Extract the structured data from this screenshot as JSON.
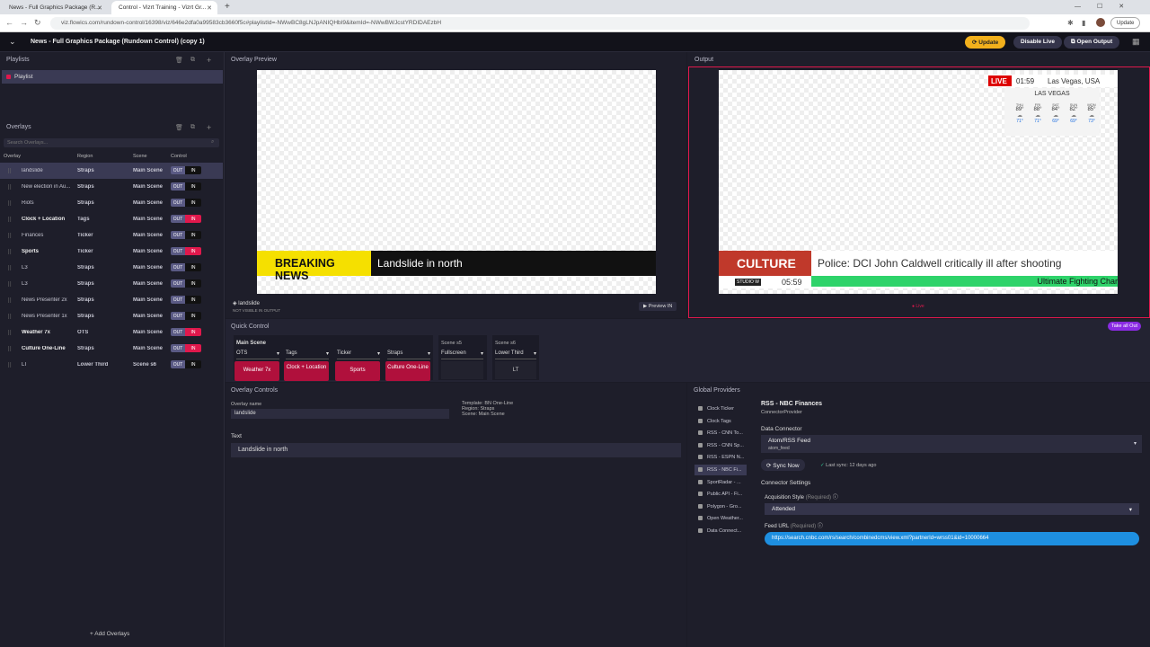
{
  "browser": {
    "tabs": [
      "News - Full Graphics Package (R...",
      "Control - Vizrt Training - Vizrt Gr..."
    ],
    "new_tab": "+",
    "url": "viz.flowics.com/rundown-control/16398/viz/646e2dfa0a99583cb3660f5c#playlistId=-NWwBC8gLNJpANIQHbI9&itemId=-NWwBWJcstYRDIDAEzbH",
    "update": "Update",
    "win_controls": [
      "—",
      "☐",
      "✕"
    ]
  },
  "header": {
    "title": "News - Full Graphics Package (Rundown Control) (copy 1)",
    "update": "Update",
    "disable_live": "Disable Live",
    "open_output": "Open Output"
  },
  "playlists": {
    "title": "Playlists",
    "items": [
      "Playlist"
    ]
  },
  "overlays": {
    "title": "Overlays",
    "search_placeholder": "Search Overlays...",
    "columns": [
      "Overlay",
      "Region",
      "Scene",
      "Control"
    ],
    "rows": [
      {
        "name": "landslide",
        "region": "Straps",
        "scene": "Main Scene",
        "in": false,
        "sel": true
      },
      {
        "name": "New election in Au...",
        "region": "Straps",
        "scene": "Main Scene",
        "in": false
      },
      {
        "name": "Riots",
        "region": "Straps",
        "scene": "Main Scene",
        "in": false
      },
      {
        "name": "Clock + Location",
        "region": "Tags",
        "scene": "Main Scene",
        "in": true
      },
      {
        "name": "Finances",
        "region": "Ticker",
        "scene": "Main Scene",
        "in": false
      },
      {
        "name": "Sports",
        "region": "Ticker",
        "scene": "Main Scene",
        "in": true
      },
      {
        "name": "L3",
        "region": "Straps",
        "scene": "Main Scene",
        "in": false
      },
      {
        "name": "L3",
        "region": "Straps",
        "scene": "Main Scene",
        "in": false
      },
      {
        "name": "News Presenter 2x",
        "region": "Straps",
        "scene": "Main Scene",
        "in": false
      },
      {
        "name": "News Presenter 1x",
        "region": "Straps",
        "scene": "Main Scene",
        "in": false
      },
      {
        "name": "Weather 7x",
        "region": "OTS",
        "scene": "Main Scene",
        "in": true
      },
      {
        "name": "Culture One-Line",
        "region": "Straps",
        "scene": "Main Scene",
        "in": true
      },
      {
        "name": "LT",
        "region": "Lower Third",
        "scene": "Scene s6",
        "in": false
      }
    ],
    "out_label": "OUT",
    "in_label": "IN",
    "add": "+ Add Overlays"
  },
  "preview": {
    "title": "Overlay Preview",
    "breaking": "BREAKING NEWS",
    "headline": "Landslide in north",
    "overlay_name": "landslide",
    "not_visible": "NOT VISIBLE IN OUTPUT",
    "preview_in": "Preview IN"
  },
  "output": {
    "title": "Output",
    "live": "LIVE",
    "time": "01:59",
    "location": "Las Vegas, USA",
    "weather_city": "LAS VEGAS",
    "days": [
      "THU",
      "FRI",
      "SAT",
      "SUN",
      "MON"
    ],
    "highs": [
      "89°",
      "88°",
      "84°",
      "82°",
      "85°"
    ],
    "lows": [
      "71°",
      "71°",
      "69°",
      "69°",
      "73°"
    ],
    "culture": "CULTURE",
    "culture_headline": "Police: DCI John Caldwell critically ill after shooting",
    "studio": "STUDIO W",
    "clock2": "05:59",
    "ticker": "Ultimate Fighting Char",
    "indicator": "Live"
  },
  "quick": {
    "title": "Quick Control",
    "take_all_out": "Take all Out",
    "main_scene": "Main Scene",
    "selectors": [
      "OTS",
      "Tags",
      "Ticker",
      "Straps"
    ],
    "buttons": [
      "Weather 7x",
      "Clock + Location",
      "Sports",
      "Culture One-Line"
    ],
    "scene5": "Scene s5",
    "scene5_sel": "Fullscreen",
    "scene6": "Scene s6",
    "scene6_sel": "Lower Third",
    "scene6_btn": "LT"
  },
  "overlay_controls": {
    "title": "Overlay Controls",
    "name_label": "Overlay name",
    "name_value": "landslide",
    "template": "Template: BN One-Line",
    "region": "Region: Straps",
    "scene": "Scene: Main Scene",
    "text_label": "Text",
    "text_value": "Landslide in north"
  },
  "global": {
    "title": "Global Providers",
    "items": [
      "Clock Ticker",
      "Clock Tags",
      "RSS - CNN To...",
      "RSS - CNN Sp...",
      "RSS - ESPN N...",
      "RSS - NBC Fi...",
      "SportRadar - ...",
      "Public API - Fi...",
      "Polygon - Gro...",
      "Open Weather...",
      "Data Connect..."
    ],
    "selected": 5,
    "provider_name": "RSS - NBC Finances",
    "provider_type": "ConnectorProvider",
    "data_connector": "Data Connector",
    "connector": "Atom/RSS Feed",
    "connector_sub": "atom_feed",
    "sync": "Sync Now",
    "last_sync": "Last sync: 12 days ago",
    "settings": "Connector Settings",
    "acq_label": "Acquisition Style",
    "required": "(Required)",
    "acq_value": "Attended",
    "feed_label": "Feed URL",
    "feed_value": "https://search.cnbc.com/rs/search/combinedcms/view.xml?partnerId=wrss01&id=10000664"
  }
}
